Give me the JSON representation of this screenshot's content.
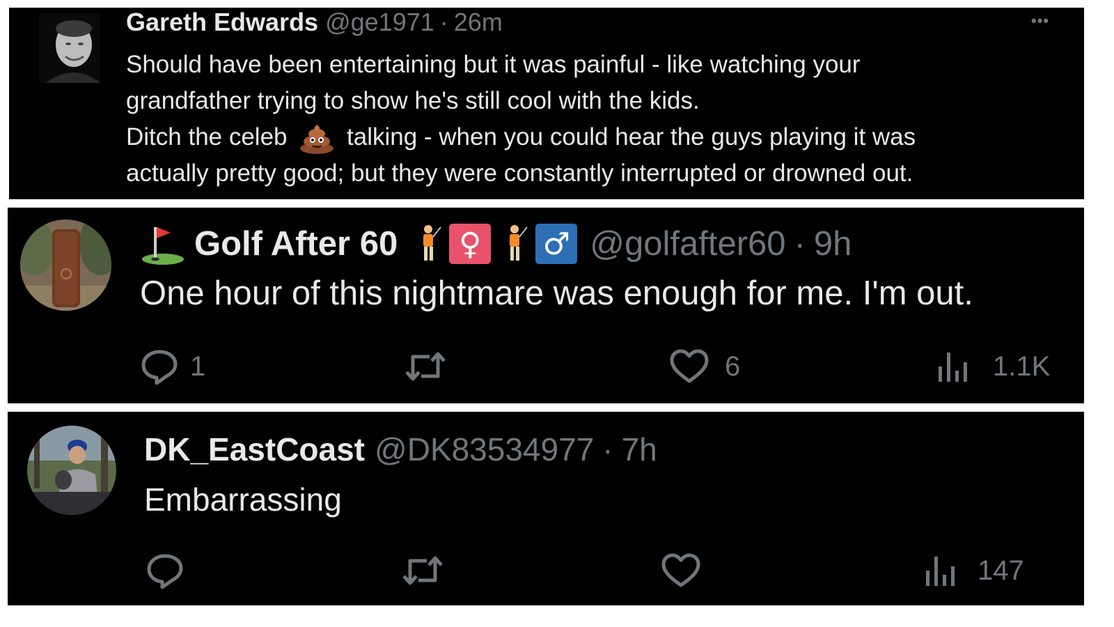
{
  "colors": {
    "background": "#000000",
    "text_primary": "#e7e9ea",
    "text_secondary": "#71767b",
    "female_badge": "#e8536b",
    "male_badge": "#2d6fb4"
  },
  "tweets": [
    {
      "name": "Gareth Edwards",
      "handle": "@ge1971",
      "separator": "·",
      "time": "26m",
      "more_icon": "more-dots-icon",
      "more_label": "•••",
      "text_lines": [
        "Should have been entertaining but it was painful - like watching your",
        "grandfather trying to show he's still cool with the kids."
      ],
      "line3_before": "Ditch the celeb",
      "line3_emoji": "pile-of-poo-icon",
      "line3_after": "talking - when you could hear the guys playing it was",
      "line4": "actually pretty good; but they were constantly interrupted or drowned out."
    },
    {
      "name_prefix_icon": "golf-flag-icon",
      "name": "Golf After 60",
      "name_suffix_icons": [
        "golfer-icon",
        "female-sign-icon",
        "golfer-icon",
        "male-sign-icon"
      ],
      "female_symbol": "♀",
      "male_symbol": "♂",
      "handle": "@golfafter60",
      "separator": "·",
      "time": "9h",
      "text": "One hour of this nightmare was enough for me. I'm out.",
      "actions": {
        "reply_count": "1",
        "retweet_count": "",
        "like_count": "6",
        "views_count": "1.1K"
      }
    },
    {
      "name": "DK_EastCoast",
      "handle": "@DK83534977",
      "separator": "·",
      "time": "7h",
      "text": "Embarrassing",
      "actions": {
        "reply_count": "",
        "retweet_count": "",
        "like_count": "",
        "views_count": "147"
      }
    }
  ]
}
